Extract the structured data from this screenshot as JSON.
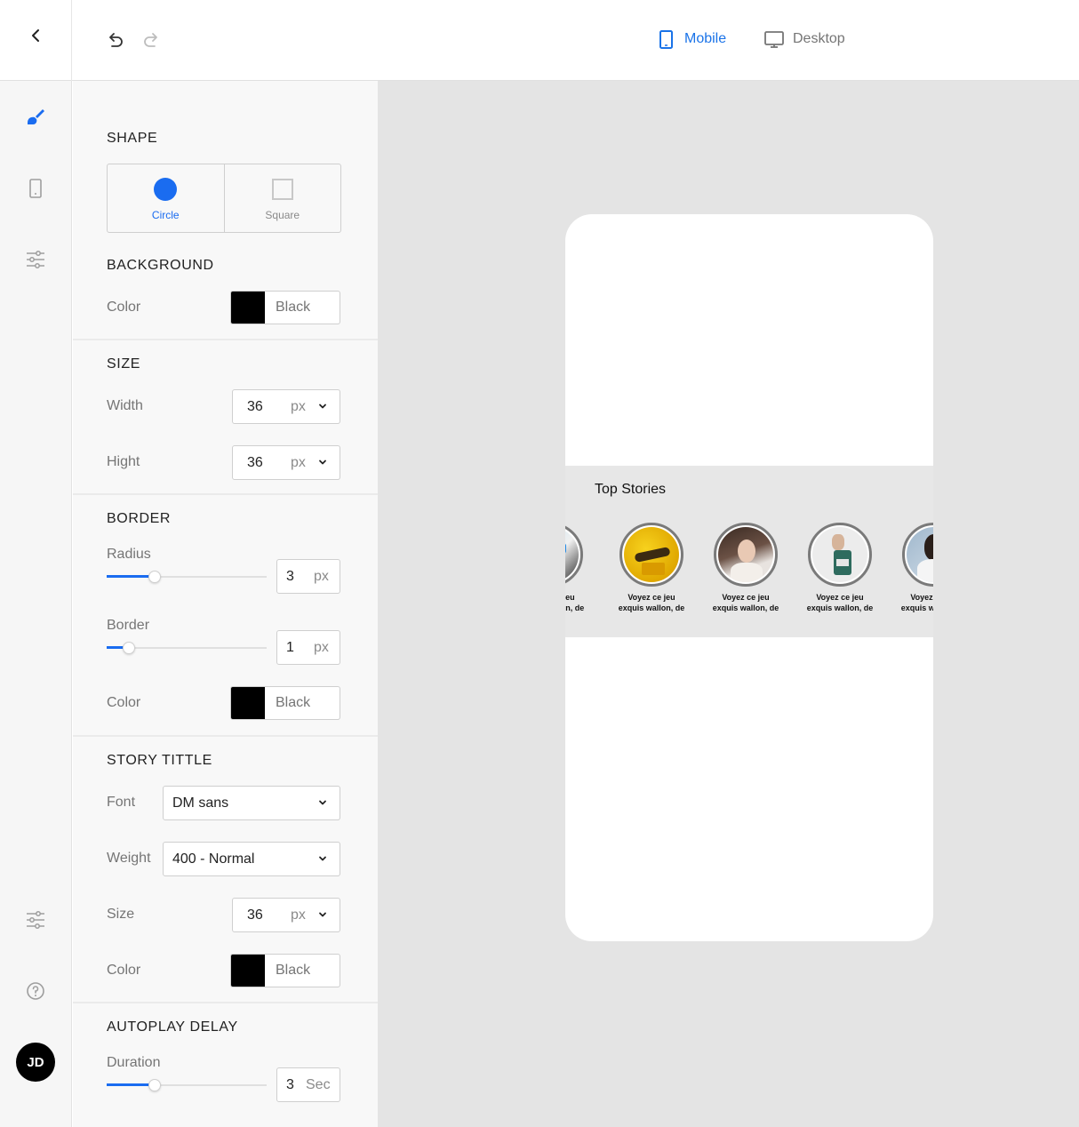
{
  "header": {
    "back_icon": "chevron-left-icon",
    "undo_icon": "undo-icon",
    "redo_icon": "redo-icon",
    "views": [
      {
        "label": "Mobile",
        "icon": "phone-icon",
        "active": true
      },
      {
        "label": "Desktop",
        "icon": "monitor-icon",
        "active": false
      }
    ]
  },
  "rail": {
    "items": [
      {
        "icon": "brush-icon",
        "active": true
      },
      {
        "icon": "phone-outline-icon",
        "active": false
      },
      {
        "icon": "sliders-icon",
        "active": false
      }
    ],
    "bottom": [
      {
        "icon": "sliders-icon"
      },
      {
        "icon": "help-icon"
      }
    ],
    "avatar_initials": "JD"
  },
  "panel": {
    "shape": {
      "title": "SHAPE",
      "options": [
        {
          "label": "Circle",
          "selected": true
        },
        {
          "label": "Square",
          "selected": false
        }
      ]
    },
    "background": {
      "title": "BACKGROUND",
      "color_label": "Color",
      "color_value": "Black"
    },
    "size": {
      "title": "SIZE",
      "width_label": "Width",
      "width_value": "36",
      "width_unit": "px",
      "height_label": "Hight",
      "height_value": "36",
      "height_unit": "px"
    },
    "border": {
      "title": "BORDER",
      "radius_label": "Radius",
      "radius_value": "3",
      "radius_unit": "px",
      "radius_slider": 0.3,
      "border_label": "Border",
      "border_value": "1",
      "border_unit": "px",
      "border_slider": 0.14,
      "color_label": "Color",
      "color_value": "Black"
    },
    "story_title": {
      "title": "STORY TITTLE",
      "font_label": "Font",
      "font_value": "DM sans",
      "weight_label": "Weight",
      "weight_value": "400 - Normal",
      "size_label": "Size",
      "size_value": "36",
      "size_unit": "px",
      "color_label": "Color",
      "color_value": "Black"
    },
    "autoplay": {
      "title": "AUTOPLAY DELAY",
      "duration_label": "Duration",
      "duration_value": "3",
      "duration_unit": "Sec",
      "duration_slider": 0.3
    }
  },
  "preview": {
    "stories_title": "Top Stories",
    "stories": [
      {
        "caption_line1": "Voyez ce jeu",
        "caption_line2": "exquis wallon, de"
      },
      {
        "caption_line1": "Voyez ce jeu",
        "caption_line2": "exquis wallon, de"
      },
      {
        "caption_line1": "Voyez ce jeu",
        "caption_line2": "exquis wallon, de"
      },
      {
        "caption_line1": "Voyez ce jeu",
        "caption_line2": "exquis wallon, de"
      },
      {
        "caption_line1": "Voyez ce jeu",
        "caption_line2": "exquis wallon, de"
      }
    ]
  },
  "colors": {
    "accent": "#1a73e8",
    "swatch": "#000000",
    "canvas_bg": "#e4e4e4"
  }
}
